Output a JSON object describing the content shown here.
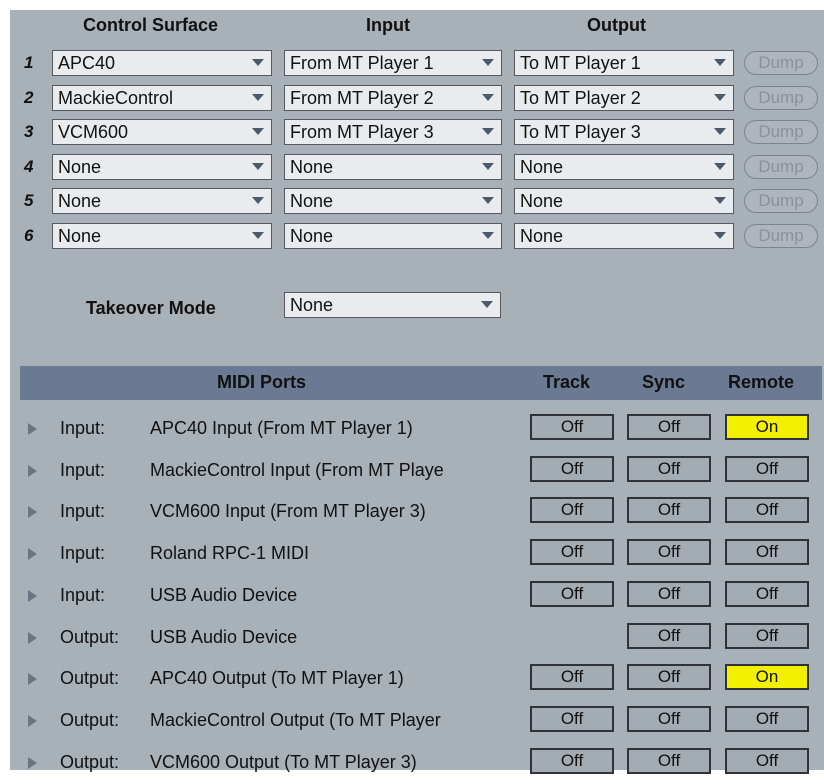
{
  "headers": {
    "control_surface": "Control Surface",
    "input": "Input",
    "output": "Output"
  },
  "surfaces": [
    {
      "num": "1",
      "control": "APC40",
      "input": "From MT Player 1",
      "output": "To MT Player 1",
      "dump": "Dump"
    },
    {
      "num": "2",
      "control": "MackieControl",
      "input": "From MT Player 2",
      "output": "To MT Player 2",
      "dump": "Dump"
    },
    {
      "num": "3",
      "control": "VCM600",
      "input": "From MT Player 3",
      "output": "To MT Player 3",
      "dump": "Dump"
    },
    {
      "num": "4",
      "control": "None",
      "input": "None",
      "output": "None",
      "dump": "Dump"
    },
    {
      "num": "5",
      "control": "None",
      "input": "None",
      "output": "None",
      "dump": "Dump"
    },
    {
      "num": "6",
      "control": "None",
      "input": "None",
      "output": "None",
      "dump": "Dump"
    }
  ],
  "takeover": {
    "label": "Takeover Mode",
    "value": "None"
  },
  "midi": {
    "title": "MIDI Ports",
    "track": "Track",
    "sync": "Sync",
    "remote": "Remote",
    "ports": [
      {
        "type": "Input:",
        "name": "APC40 Input (From MT Player 1)",
        "track": "Off",
        "sync": "Off",
        "remote": "On"
      },
      {
        "type": "Input:",
        "name": "MackieControl Input (From MT Playe",
        "track": "Off",
        "sync": "Off",
        "remote": "Off"
      },
      {
        "type": "Input:",
        "name": "VCM600 Input (From MT Player 3)",
        "track": "Off",
        "sync": "Off",
        "remote": "Off"
      },
      {
        "type": "Input:",
        "name": "Roland RPC-1 MIDI",
        "track": "Off",
        "sync": "Off",
        "remote": "Off"
      },
      {
        "type": "Input:",
        "name": "USB Audio Device",
        "track": "Off",
        "sync": "Off",
        "remote": "Off"
      },
      {
        "type": "Output:",
        "name": "USB Audio Device",
        "track": "",
        "sync": "Off",
        "remote": "Off"
      },
      {
        "type": "Output:",
        "name": "APC40 Output (To MT Player 1)",
        "track": "Off",
        "sync": "Off",
        "remote": "On"
      },
      {
        "type": "Output:",
        "name": "MackieControl Output (To MT Player",
        "track": "Off",
        "sync": "Off",
        "remote": "Off"
      },
      {
        "type": "Output:",
        "name": "VCM600 Output (To MT Player 3)",
        "track": "Off",
        "sync": "Off",
        "remote": "Off"
      }
    ]
  },
  "colors": {
    "panel": "#a8b0b8",
    "midi_header": "#6a7a92",
    "on": "#f2f000"
  }
}
